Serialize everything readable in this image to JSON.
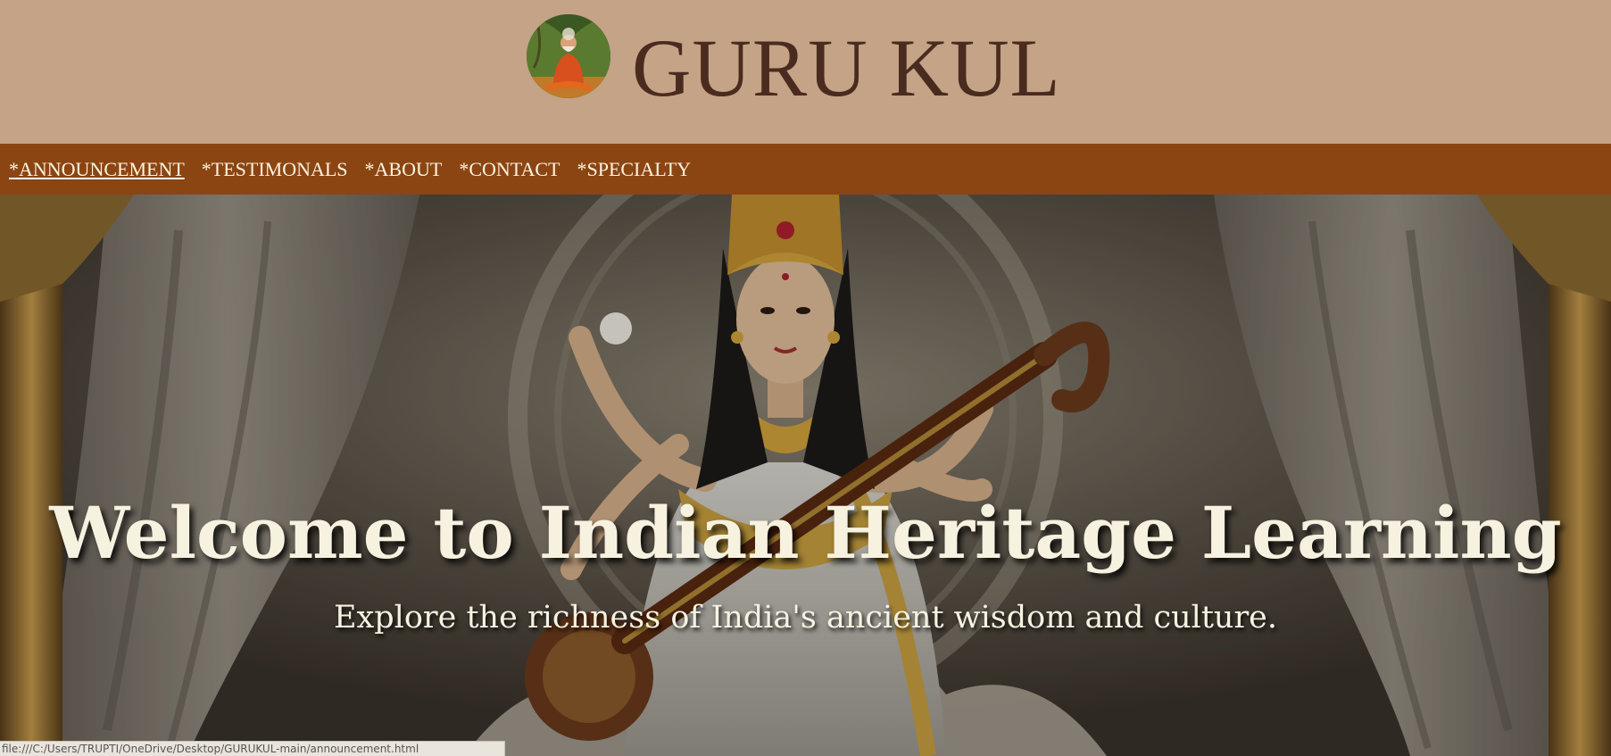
{
  "header": {
    "logo_icon": "meditating-sage-icon",
    "title": "GURU KUL"
  },
  "nav": {
    "items": [
      {
        "label": "*ANNOUNCEMENT",
        "active": true
      },
      {
        "label": "*TESTIMONALS"
      },
      {
        "label": "*ABOUT"
      },
      {
        "label": "*CONTACT"
      },
      {
        "label": "*SPECIALTY"
      }
    ]
  },
  "hero": {
    "image_icon": "saraswati-with-veena-image",
    "title": "Welcome to Indian Heritage Learning",
    "subtitle": "Explore the richness of India's ancient wisdom and culture."
  },
  "status_bar": {
    "url": "file:///C:/Users/TRUPTI/OneDrive/Desktop/GURUKUL-main/announcement.html"
  },
  "colors": {
    "header_bg": "#c4a386",
    "nav_bg": "#8b4513",
    "title_text": "#4a2b1f",
    "nav_text": "#fff4e0",
    "hero_text": "#f7f2e0"
  }
}
